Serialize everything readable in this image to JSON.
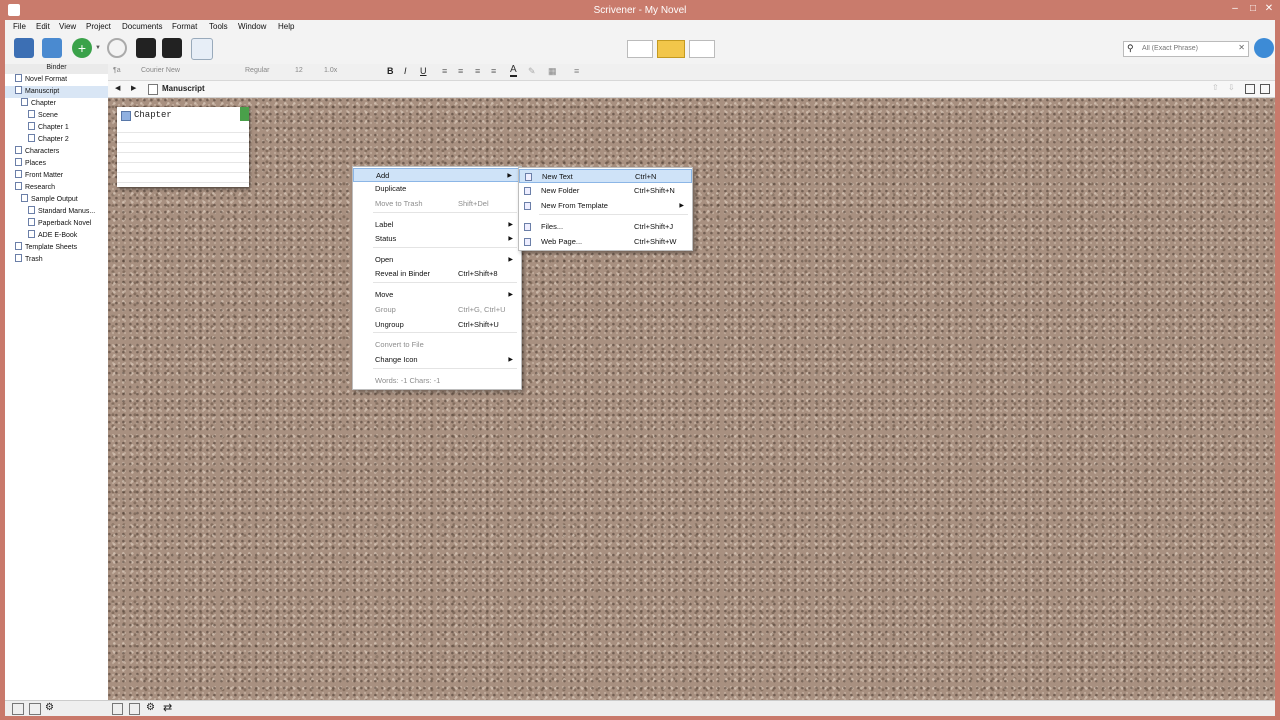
{
  "window": {
    "title": "Scrivener - My Novel"
  },
  "menubar": [
    "File",
    "Edit",
    "View",
    "Project",
    "Documents",
    "Format",
    "Tools",
    "Window",
    "Help"
  ],
  "search": {
    "placeholder": "All (Exact Phrase)"
  },
  "binder": {
    "header": "Binder",
    "items": [
      {
        "label": "Novel Format",
        "indent": 0
      },
      {
        "label": "Manuscript",
        "indent": 0
      },
      {
        "label": "Chapter",
        "indent": 1
      },
      {
        "label": "Scene",
        "indent": 2
      },
      {
        "label": "Chapter 1",
        "indent": 2
      },
      {
        "label": "Chapter 2",
        "indent": 2
      },
      {
        "label": "Characters",
        "indent": 0
      },
      {
        "label": "Places",
        "indent": 0
      },
      {
        "label": "Front Matter",
        "indent": 0
      },
      {
        "label": "Research",
        "indent": 0
      },
      {
        "label": "Sample Output",
        "indent": 1
      },
      {
        "label": "Standard Manus...",
        "indent": 2
      },
      {
        "label": "Paperback Novel",
        "indent": 2
      },
      {
        "label": "ADE E-Book",
        "indent": 2
      },
      {
        "label": "Template Sheets",
        "indent": 0
      },
      {
        "label": "Trash",
        "indent": 0
      }
    ]
  },
  "format_bar": {
    "paragraph": "¶a",
    "font": "Courier New",
    "style": "Regular",
    "size": "12",
    "spacing": "1.0x"
  },
  "editor_header": {
    "title": "Manuscript"
  },
  "card": {
    "title": "Chapter"
  },
  "context_menu": {
    "items": [
      {
        "label": "Add",
        "shortcut": "",
        "submenu": true,
        "disabled": false,
        "highlight": true
      },
      {
        "label": "Duplicate",
        "shortcut": "",
        "submenu": false,
        "disabled": false
      },
      {
        "label": "Move to Trash",
        "shortcut": "Shift+Del",
        "submenu": false,
        "disabled": true
      },
      {
        "label": "Label",
        "shortcut": "",
        "submenu": true,
        "disabled": false
      },
      {
        "label": "Status",
        "shortcut": "",
        "submenu": true,
        "disabled": false
      },
      {
        "label": "Open",
        "shortcut": "",
        "submenu": true,
        "disabled": false
      },
      {
        "label": "Reveal in Binder",
        "shortcut": "Ctrl+Shift+8",
        "submenu": false,
        "disabled": false
      },
      {
        "label": "Move",
        "shortcut": "",
        "submenu": true,
        "disabled": false
      },
      {
        "label": "Group",
        "shortcut": "Ctrl+G, Ctrl+U",
        "submenu": false,
        "disabled": true
      },
      {
        "label": "Ungroup",
        "shortcut": "Ctrl+Shift+U",
        "submenu": false,
        "disabled": false
      },
      {
        "label": "Convert to File",
        "shortcut": "",
        "submenu": false,
        "disabled": true
      },
      {
        "label": "Change Icon",
        "shortcut": "",
        "submenu": true,
        "disabled": false
      },
      {
        "label": "Words: -1    Chars: -1",
        "shortcut": "",
        "submenu": false,
        "disabled": true
      }
    ]
  },
  "submenu": {
    "items": [
      {
        "label": "New Text",
        "shortcut": "Ctrl+N",
        "submenu": false,
        "highlight": true
      },
      {
        "label": "New Folder",
        "shortcut": "Ctrl+Shift+N",
        "submenu": false
      },
      {
        "label": "New From Template",
        "shortcut": "",
        "submenu": true
      },
      {
        "label": "Files...",
        "shortcut": "Ctrl+Shift+J",
        "submenu": false
      },
      {
        "label": "Web Page...",
        "shortcut": "Ctrl+Shift+W",
        "submenu": false
      }
    ]
  }
}
